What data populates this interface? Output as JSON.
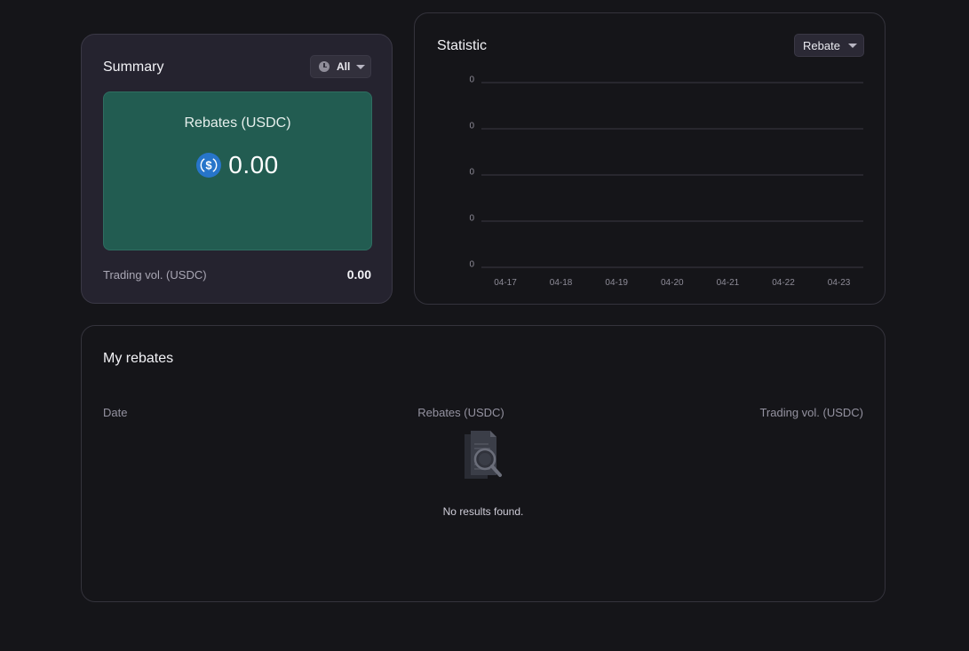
{
  "summary": {
    "title": "Summary",
    "period": "All",
    "rebates_label": "Rebates (USDC)",
    "rebates_amount": "0.00",
    "trading_label": "Trading vol. (USDC)",
    "trading_value": "0.00"
  },
  "statistic": {
    "title": "Statistic",
    "metric": "Rebate"
  },
  "chart_data": {
    "type": "line",
    "title": "",
    "x": [
      "04-17",
      "04-18",
      "04-19",
      "04-20",
      "04-21",
      "04-22",
      "04-23"
    ],
    "y_tick_labels": [
      "0",
      "0",
      "0",
      "0",
      "0"
    ],
    "series": [
      {
        "values": [
          0,
          0,
          0,
          0,
          0,
          0,
          0
        ]
      }
    ],
    "grid": true
  },
  "my_rebates": {
    "title": "My rebates",
    "columns": [
      "Date",
      "Rebates (USDC)",
      "Trading vol. (USDC)"
    ],
    "rows": [],
    "empty_text": "No results found."
  },
  "colors": {
    "background": "#151519",
    "summary_card": "#25232f",
    "rebate_box": "#225c51",
    "usdc_blue": "#2775ca",
    "grid_line": "#3a3944"
  },
  "icons": {
    "period": "clock-icon",
    "currency": "usdc-coin-icon",
    "empty": "document-search-icon",
    "dropdown": "chevron-down-icon"
  }
}
